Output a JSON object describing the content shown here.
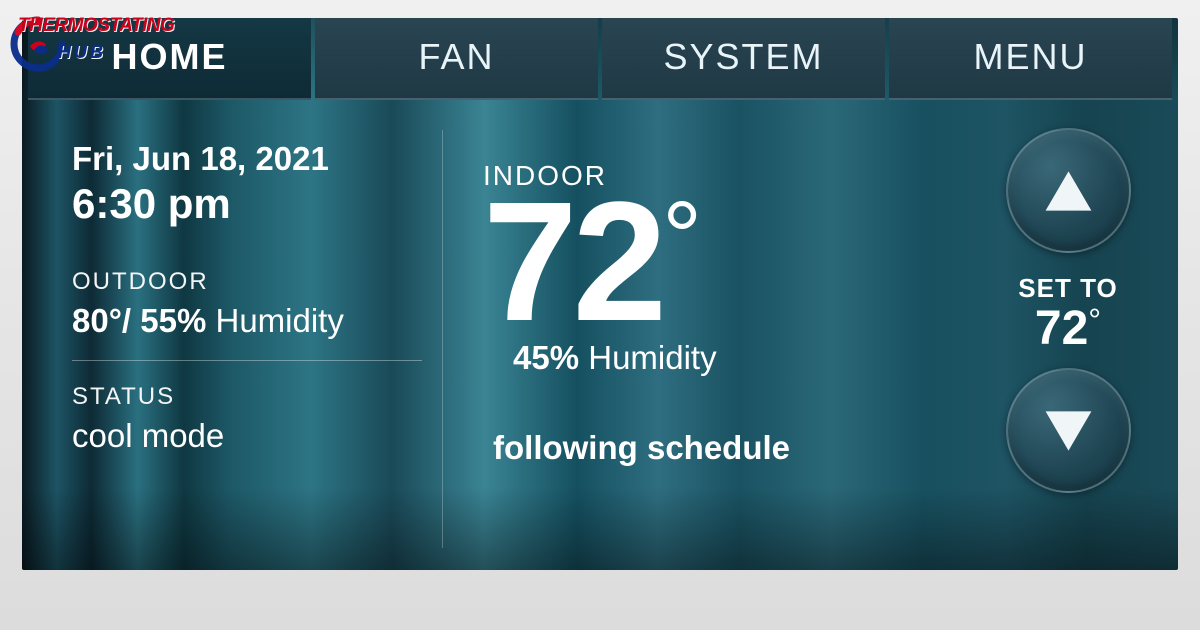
{
  "watermark": {
    "line1": "THERMOSTATING",
    "line2": "HUB"
  },
  "tabs": {
    "home": "HOME",
    "fan": "FAN",
    "system": "SYSTEM",
    "menu": "MENU"
  },
  "left": {
    "date": "Fri, Jun 18, 2021",
    "time": "6:30 pm",
    "outdoor_label": "OUTDOOR",
    "outdoor_temp": "80°",
    "outdoor_sep": "/ ",
    "outdoor_humidity_value": "55%",
    "outdoor_humidity_word": " Humidity",
    "status_label": "STATUS",
    "status_value": "cool mode"
  },
  "center": {
    "indoor_label": "INDOOR",
    "indoor_temp": "72",
    "degree": "°",
    "humidity_value": "45%",
    "humidity_word": " Humidity",
    "schedule": "following schedule"
  },
  "right": {
    "set_to_label": "SET TO",
    "set_to_value": "72",
    "degree": "°"
  }
}
